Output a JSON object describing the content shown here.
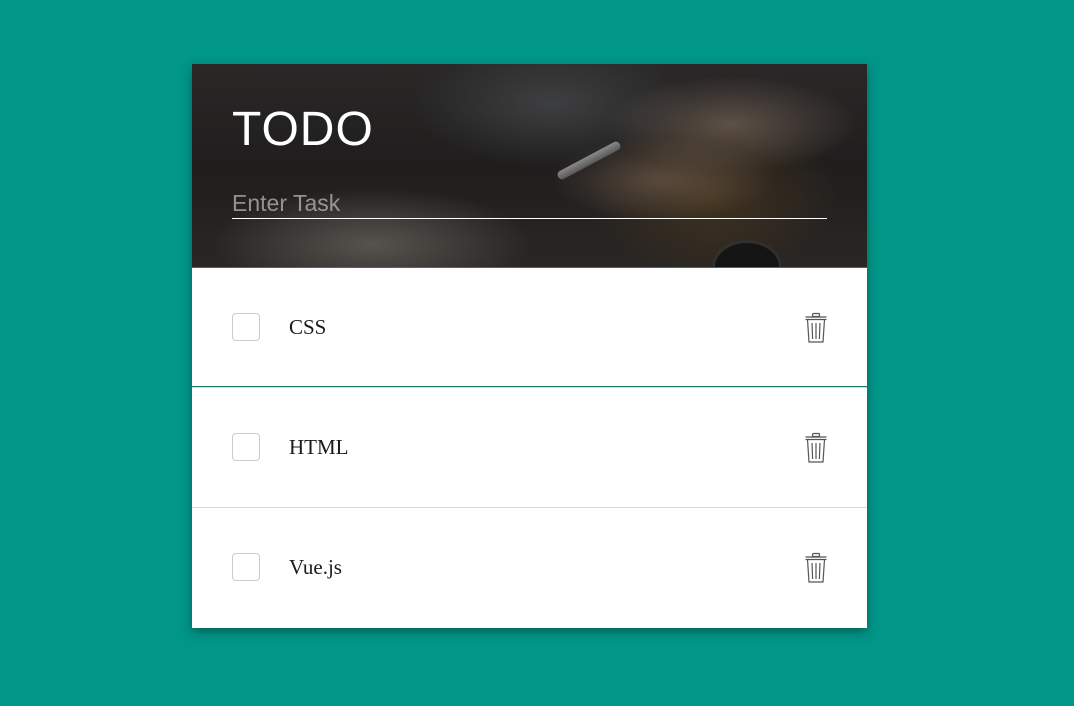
{
  "app": {
    "title": "TODO",
    "input": {
      "placeholder": "Enter Task",
      "value": ""
    }
  },
  "tasks": [
    {
      "label": "CSS",
      "checked": false
    },
    {
      "label": "HTML",
      "checked": false
    },
    {
      "label": "Vue.js",
      "checked": false
    }
  ],
  "icons": {
    "delete": "trash-icon"
  },
  "colors": {
    "background": "#009688",
    "card": "#ffffff",
    "divider": "#d6d6d6",
    "accent_divider": "#1f7a72"
  }
}
